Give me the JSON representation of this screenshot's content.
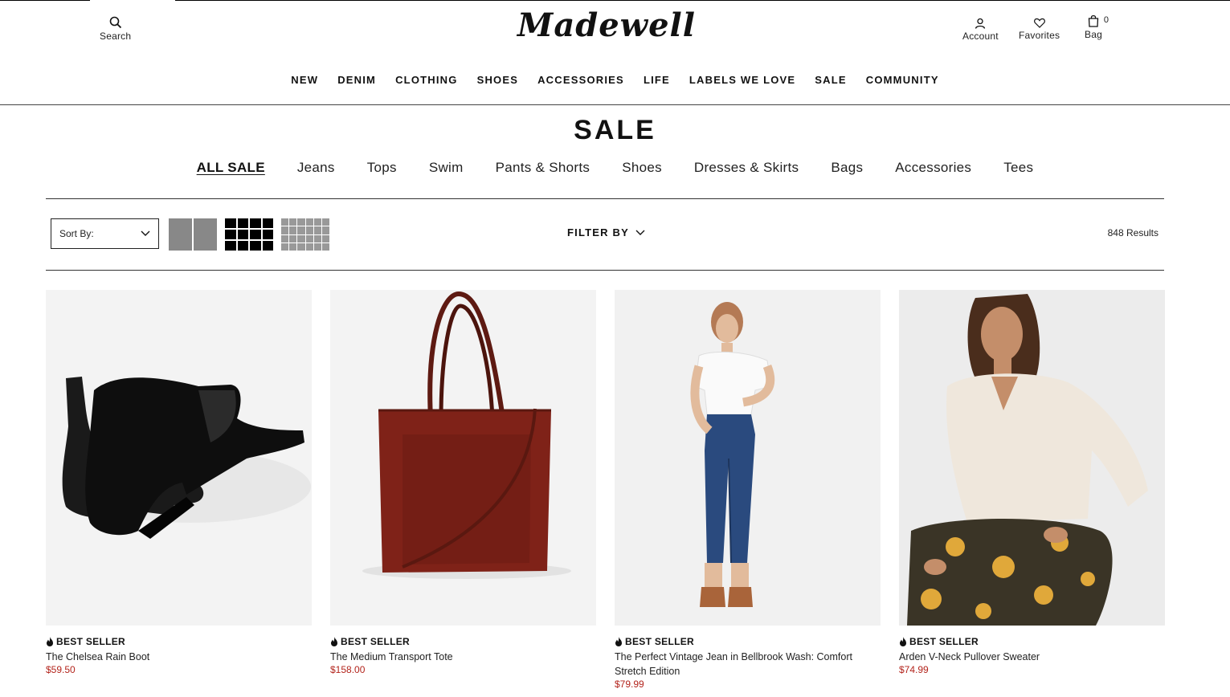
{
  "header": {
    "logo": "Madewell",
    "search_label": "Search",
    "account_label": "Account",
    "favorites_label": "Favorites",
    "bag_label": "Bag",
    "bag_count": "0"
  },
  "nav": {
    "items": [
      "NEW",
      "DENIM",
      "CLOTHING",
      "SHOES",
      "ACCESSORIES",
      "LIFE",
      "LABELS WE LOVE",
      "SALE",
      "COMMUNITY"
    ]
  },
  "page": {
    "title": "SALE"
  },
  "subnav": {
    "items": [
      "ALL SALE",
      "Jeans",
      "Tops",
      "Swim",
      "Pants & Shorts",
      "Shoes",
      "Dresses & Skirts",
      "Bags",
      "Accessories",
      "Tees"
    ],
    "active": "ALL SALE"
  },
  "toolbar": {
    "sort_label": "Sort By:",
    "filter_label": "FILTER BY",
    "results": "848 Results"
  },
  "products": [
    {
      "badge": "BEST SELLER",
      "name": "The Chelsea Rain Boot",
      "price": "$59.50"
    },
    {
      "badge": "BEST SELLER",
      "name": "The Medium Transport Tote",
      "price": "$158.00"
    },
    {
      "badge": "BEST SELLER",
      "name": "The Perfect Vintage Jean in Bellbrook Wash: Comfort Stretch Edition",
      "price": "$79.99"
    },
    {
      "badge": "BEST SELLER",
      "name": "Arden V-Neck Pullover Sweater",
      "price": "$74.99"
    }
  ],
  "colors": {
    "price": "#b3241c",
    "text": "#111111"
  }
}
